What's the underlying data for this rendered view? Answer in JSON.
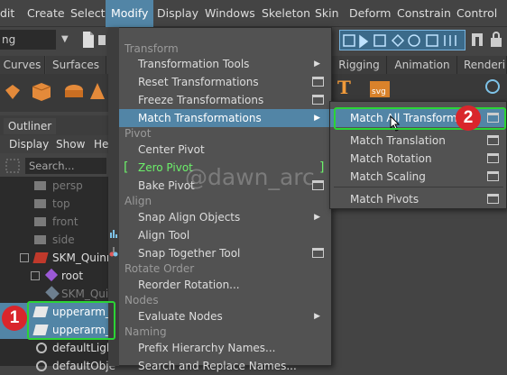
{
  "menubar": {
    "items": [
      {
        "label": "Edit"
      },
      {
        "label": "Create"
      },
      {
        "label": "Select"
      },
      {
        "label": "Modify"
      },
      {
        "label": "Display"
      },
      {
        "label": "Windows"
      },
      {
        "label": "Skeleton"
      },
      {
        "label": "Skin"
      },
      {
        "label": "Deform"
      },
      {
        "label": "Constrain"
      },
      {
        "label": "Control"
      }
    ],
    "edit_visible": "dit"
  },
  "toolbar": {
    "mode_value": "ng"
  },
  "shelf": {
    "tabs_left": [
      "Curves",
      "Surfaces"
    ],
    "tabs_right": [
      "Rigging",
      "Animation",
      "Renderin"
    ]
  },
  "outliner": {
    "title": "Outliner",
    "menu": [
      "Display",
      "Show",
      "He"
    ],
    "search_placeholder": "Search...",
    "rows": [
      {
        "label": "persp"
      },
      {
        "label": "top"
      },
      {
        "label": "front"
      },
      {
        "label": "side"
      },
      {
        "label": "SKM_Quinn"
      },
      {
        "label": "root"
      },
      {
        "label": "SKM_Quin"
      },
      {
        "label": "upperarm_l"
      },
      {
        "label": "upperarm_l"
      },
      {
        "label": "defaultLigh"
      },
      {
        "label": "defaultObje"
      }
    ]
  },
  "modify_menu": {
    "sections": {
      "transform": "Transform",
      "pivot": "Pivot",
      "align": "Align",
      "rotate_order": "Rotate Order",
      "nodes": "Nodes",
      "naming": "Naming"
    },
    "items": {
      "transformation_tools": "Transformation Tools",
      "reset_transformations": "Reset Transformations",
      "freeze_transformations": "Freeze Transformations",
      "match_transformations": "Match Transformations",
      "center_pivot": "Center Pivot",
      "zero_pivot": "Zero Pivot",
      "bake_pivot": "Bake Pivot",
      "snap_align_objects": "Snap Align Objects",
      "align_tool": "Align Tool",
      "snap_together_tool": "Snap Together Tool",
      "reorder_rotation": "Reorder Rotation...",
      "evaluate_nodes": "Evaluate Nodes",
      "prefix_hierarchy_names": "Prefix Hierarchy Names...",
      "search_and_replace_names": "Search and Replace Names..."
    }
  },
  "match_submenu": {
    "items": {
      "match_all_transforms": "Match All Transforms",
      "match_translation": "Match Translation",
      "match_rotation": "Match Rotation",
      "match_scaling": "Match Scaling",
      "match_pivots": "Match Pivots"
    }
  },
  "callouts": {
    "one": "1",
    "two": "2"
  },
  "watermark": "@dawn_arc",
  "colors": {
    "highlight": "#5285a6",
    "callout_red": "#d9262c",
    "callout_green": "#2bd435",
    "zero_pivot_green": "#6cf06a"
  }
}
